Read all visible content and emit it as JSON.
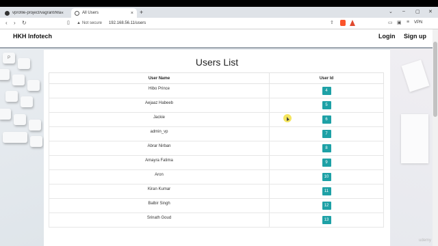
{
  "browser": {
    "tabs": [
      {
        "label": "vprofile-project/vagrant/Manual_pr...",
        "active": false
      },
      {
        "label": "All Users",
        "active": true
      }
    ],
    "security_label": "Not secure",
    "url": "192.168.56.11/users",
    "vpn_label": "VPN"
  },
  "navbar": {
    "brand": "HKH Infotech",
    "login": "Login",
    "signup": "Sign up"
  },
  "page": {
    "title": "Users List",
    "columns": [
      "User Name",
      "User Id"
    ],
    "rows": [
      {
        "name": "Hibo Prince",
        "id": "4"
      },
      {
        "name": "Aejaaz Habeeb",
        "id": "5"
      },
      {
        "name": "Jackie",
        "id": "6"
      },
      {
        "name": "admin_vp",
        "id": "7"
      },
      {
        "name": "Abrar Nirban",
        "id": "8"
      },
      {
        "name": "Amayra Fatima",
        "id": "9"
      },
      {
        "name": "Aron",
        "id": "10"
      },
      {
        "name": "Kiran Kumar",
        "id": "11"
      },
      {
        "name": "Balbir Singh",
        "id": "12"
      },
      {
        "name": "Srinath Goud",
        "id": "13"
      }
    ]
  },
  "overlay": {
    "watermark": "udemy"
  },
  "colors": {
    "badge": "#1ea1a6",
    "brave": "#fb542b"
  }
}
